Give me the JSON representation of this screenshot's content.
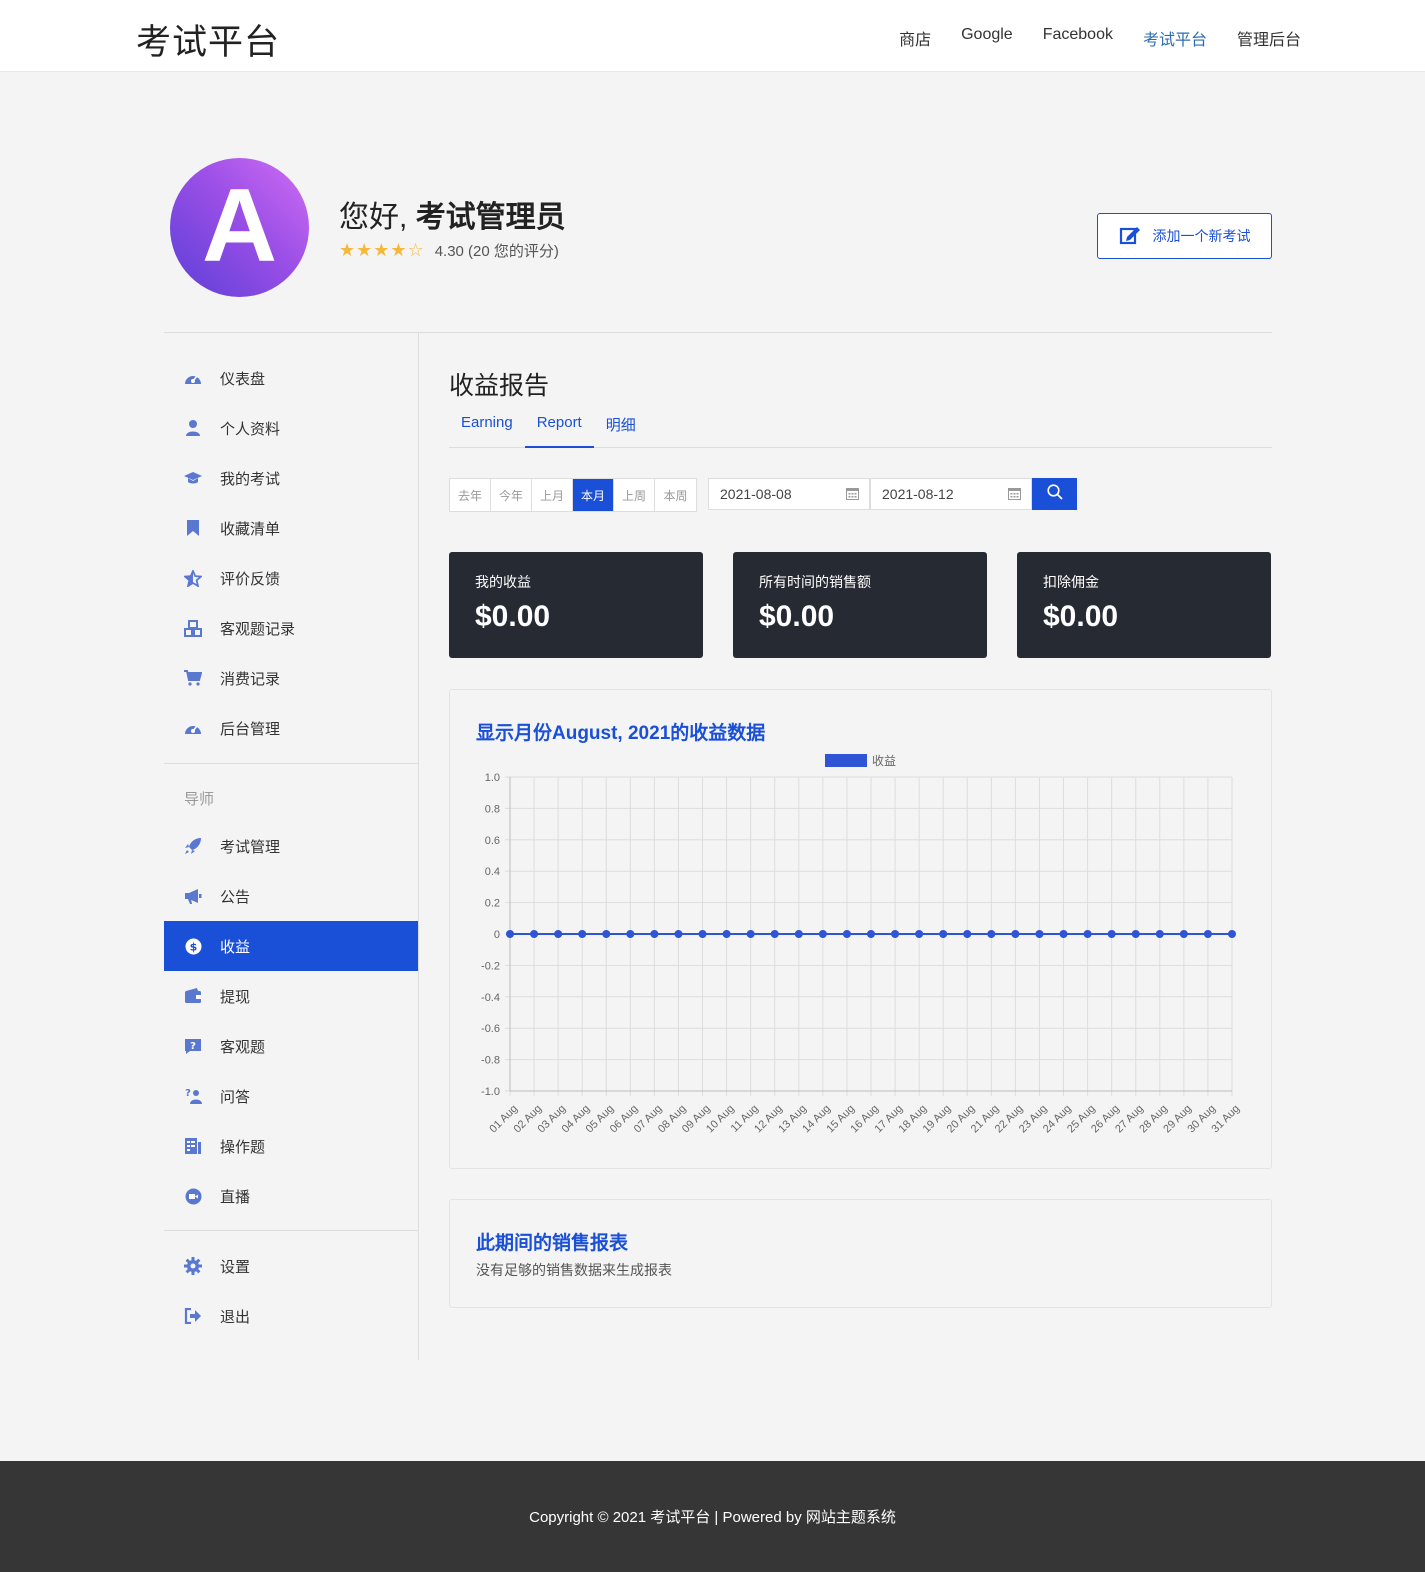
{
  "header": {
    "site_title": "考试平台",
    "nav": [
      {
        "label": "商店",
        "active": false
      },
      {
        "label": "Google",
        "active": false
      },
      {
        "label": "Facebook",
        "active": false
      },
      {
        "label": "考试平台",
        "active": true
      },
      {
        "label": "管理后台",
        "active": false
      }
    ]
  },
  "profile": {
    "avatar_letter": "A",
    "greeting_prefix": "您好,",
    "name": "考试管理员",
    "stars": "★★★★☆",
    "rating_text": "4.30 (20 您的评分)",
    "rating_value": 4.3,
    "add_button": "添加一个新考试"
  },
  "sidebar": {
    "items": [
      {
        "label": "仪表盘",
        "icon": "dashboard-icon"
      },
      {
        "label": "个人资料",
        "icon": "user-icon"
      },
      {
        "label": "我的考试",
        "icon": "graduation-cap-icon"
      },
      {
        "label": "收藏清单",
        "icon": "bookmark-icon"
      },
      {
        "label": "评价反馈",
        "icon": "star-icon"
      },
      {
        "label": "客观题记录",
        "icon": "cubes-icon"
      },
      {
        "label": "消费记录",
        "icon": "cart-icon"
      },
      {
        "label": "后台管理",
        "icon": "dashboard-icon"
      }
    ],
    "instructor_heading": "导师",
    "instructor_items": [
      {
        "label": "考试管理",
        "icon": "rocket-icon"
      },
      {
        "label": "公告",
        "icon": "megaphone-icon"
      },
      {
        "label": "收益",
        "icon": "dollar-circle-icon",
        "active": true
      },
      {
        "label": "提现",
        "icon": "wallet-icon"
      },
      {
        "label": "客观题",
        "icon": "question-icon"
      },
      {
        "label": "问答",
        "icon": "qa-icon"
      },
      {
        "label": "操作题",
        "icon": "report-icon"
      },
      {
        "label": "直播",
        "icon": "video-icon"
      }
    ],
    "bottom_items": [
      {
        "label": "设置",
        "icon": "gear-icon"
      },
      {
        "label": "退出",
        "icon": "logout-icon"
      }
    ]
  },
  "main": {
    "title": "收益报告",
    "tabs": [
      {
        "label": "Earning",
        "active": false
      },
      {
        "label": "Report",
        "active": true
      },
      {
        "label": "明细",
        "active": false
      }
    ],
    "periods": [
      {
        "label": "去年",
        "active": false
      },
      {
        "label": "今年",
        "active": false
      },
      {
        "label": "上月",
        "active": false
      },
      {
        "label": "本月",
        "active": true
      },
      {
        "label": "上周",
        "active": false
      },
      {
        "label": "本周",
        "active": false
      }
    ],
    "date_from": "2021-08-08",
    "date_to": "2021-08-12",
    "stats": [
      {
        "label": "我的收益",
        "value": "$0.00"
      },
      {
        "label": "所有时间的销售额",
        "value": "$0.00"
      },
      {
        "label": "扣除佣金",
        "value": "$0.00"
      }
    ],
    "report_title": "此期间的销售报表",
    "report_text": "没有足够的销售数据来生成报表"
  },
  "chart_data": {
    "type": "line",
    "title": "显示月份August, 2021的收益数据",
    "x": [
      "01 Aug",
      "02 Aug",
      "03 Aug",
      "04 Aug",
      "05 Aug",
      "06 Aug",
      "07 Aug",
      "08 Aug",
      "09 Aug",
      "10 Aug",
      "11 Aug",
      "12 Aug",
      "13 Aug",
      "14 Aug",
      "15 Aug",
      "16 Aug",
      "17 Aug",
      "18 Aug",
      "19 Aug",
      "20 Aug",
      "21 Aug",
      "22 Aug",
      "23 Aug",
      "24 Aug",
      "25 Aug",
      "26 Aug",
      "27 Aug",
      "28 Aug",
      "29 Aug",
      "30 Aug",
      "31 Aug"
    ],
    "series": [
      {
        "name": "收益",
        "values": [
          0,
          0,
          0,
          0,
          0,
          0,
          0,
          0,
          0,
          0,
          0,
          0,
          0,
          0,
          0,
          0,
          0,
          0,
          0,
          0,
          0,
          0,
          0,
          0,
          0,
          0,
          0,
          0,
          0,
          0,
          0
        ]
      }
    ],
    "yticks": [
      "1.0",
      "0.8",
      "0.6",
      "0.4",
      "0.2",
      "0",
      "-0.2",
      "-0.4",
      "-0.6",
      "-0.8",
      "-1.0"
    ],
    "ylim": [
      -1,
      1
    ],
    "grid": true,
    "legend": "top-center",
    "color": "#2f54d6"
  },
  "footer": {
    "text": "Copyright © 2021 考试平台 | Powered by 网站主题系统"
  }
}
